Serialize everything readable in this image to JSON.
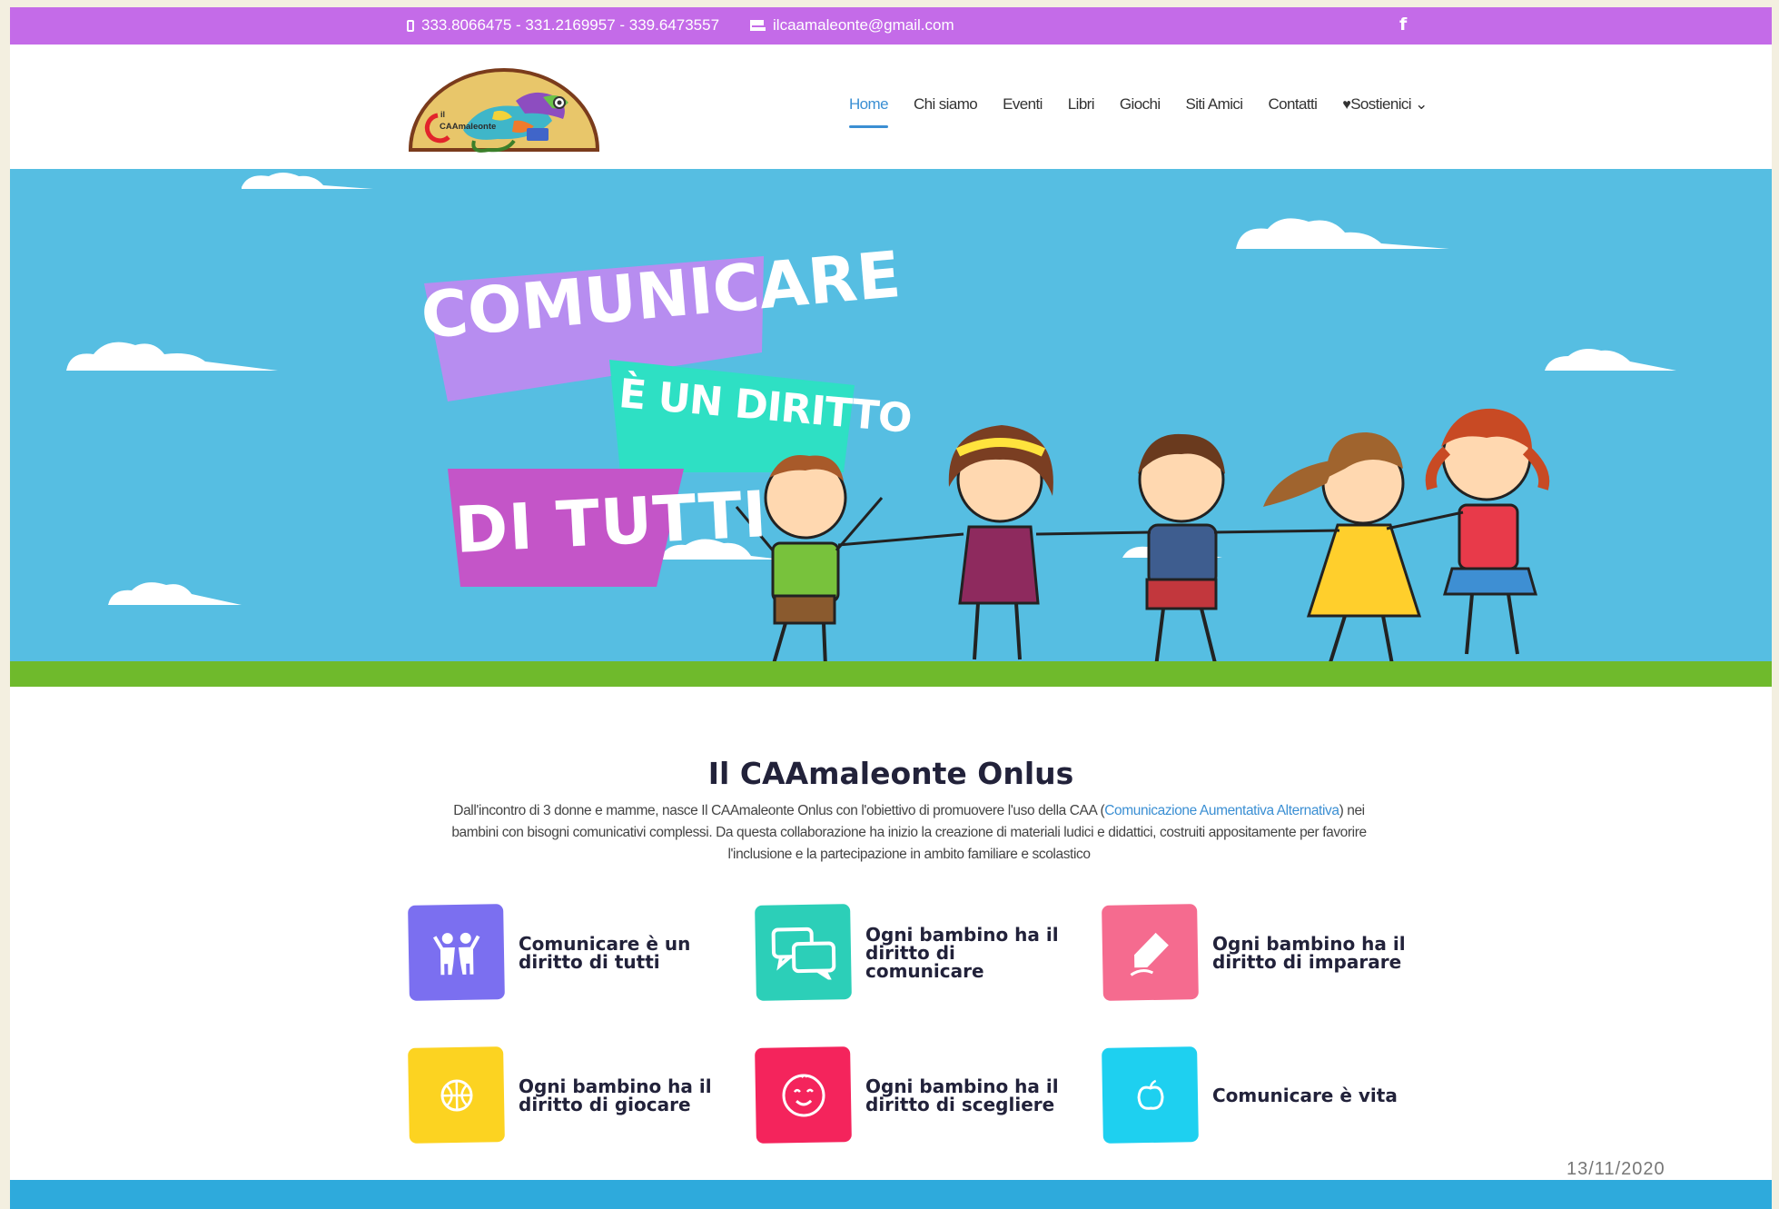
{
  "topbar": {
    "phones": "333.8066475 - 331.2169957 - 339.6473557",
    "email": "ilcaamaleonte@gmail.com"
  },
  "header": {
    "logo_text_line1": "il",
    "logo_text_line2": "CAAmaleonte",
    "nav": [
      {
        "label": "Home",
        "active": true
      },
      {
        "label": "Chi siamo"
      },
      {
        "label": "Eventi"
      },
      {
        "label": "Libri"
      },
      {
        "label": "Giochi"
      },
      {
        "label": "Siti Amici"
      },
      {
        "label": "Contatti"
      },
      {
        "label": "Sostienici"
      }
    ]
  },
  "hero": {
    "line1": "COMUNICARE",
    "line2": "È UN DIRITTO",
    "line3": "DI TUTTI"
  },
  "intro": {
    "title": "Il CAAmaleonte Onlus",
    "text_before": "Dall'incontro di 3 donne e mamme, nasce Il CAAmaleonte Onlus con l'obiettivo di promuovere l'uso della CAA (",
    "link": "Comunicazione Aumentativa Alternativa",
    "text_after": ") nei bambini con bisogni comunicativi complessi. Da questa collaborazione ha inizio la creazione di materiali ludici e didattici, costruiti appositamente per favorire l'inclusione e la partecipazione in ambito familiare e scolastico"
  },
  "features": [
    {
      "label": "Comunicare è un diritto di tutti",
      "color": "#7b6ff0",
      "icon": "people-icon"
    },
    {
      "label": "Ogni bambino ha il diritto di comunicare",
      "color": "#2ccfb8",
      "icon": "chat-bubbles-icon"
    },
    {
      "label": "Ogni bambino ha il diritto di imparare",
      "color": "#f56b8f",
      "icon": "pencil-icon"
    },
    {
      "label": "Ogni bambino ha il diritto di giocare",
      "color": "#fcd321",
      "icon": "ball-icon"
    },
    {
      "label": "Ogni bambino ha il diritto di scegliere",
      "color": "#f4245c",
      "icon": "baby-face-icon"
    },
    {
      "label": "Comunicare è vita",
      "color": "#1ed0f0",
      "icon": "apple-icon"
    }
  ],
  "footer_date": "13/11/2020",
  "colors": {
    "topbar": "#c46be8",
    "sky": "#56bee2",
    "accent": "#3b8fd3",
    "bottombar": "#2eaadc"
  }
}
